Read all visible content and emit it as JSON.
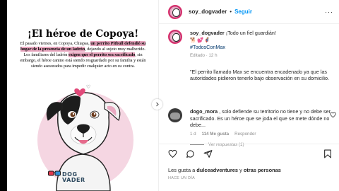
{
  "post_image": {
    "title": "¡El héroe de Copoya!",
    "body_1": "El pasado viernes, en Copoya, Chiapas, ",
    "body_2": "un perrito Pitbull defendió su hogar de la presencia de un ladrón",
    "body_3": ", dejando al sujeto muy malherido. Los familiares del ladrón ",
    "body_4": "exigen que el perrito sea sacrificado",
    "body_5": ", sin embargo, el héroe canino está siendo resguardado por su familia y están siendo asesorados para impedir cualquier acto en su contra.",
    "logo_line1": "DOG",
    "logo_line2": "VADER"
  },
  "header": {
    "username": "soy_dogvader",
    "separator": "•",
    "follow_label": "Seguir",
    "more_label": "···"
  },
  "caption": {
    "username": "soy_dogvader",
    "text": " ¡Todo un fiel guardián!",
    "emojis": "🐕💕🦸",
    "hashtag": "#TodosConMax",
    "quote": "\"El perrito llamado Max se encuentra encadenado ya que las autoridades pidieron tenerlo bajo observación en su domicilio.",
    "meta": "Editado · 12 h"
  },
  "comment": {
    "username": "dogo_mora",
    "text": " , solo defiende su territorio no tiene y no debe ser sacrificado. Es un héroe que se joda el que se mete dónde no debe...",
    "age": "1 d",
    "likes": "114 Me gusta",
    "reply": "Responder",
    "replies_label": "Ver respuestas (1)"
  },
  "likes": {
    "prefix": "Les gusta a ",
    "user": "dulceadventures",
    "middle": " y ",
    "others": "otras personas"
  },
  "date": "HACE UN DÍA",
  "colors": {
    "accent": "#0095f6",
    "text": "#262626",
    "muted": "#8e8e8e",
    "hashtag": "#00376b",
    "highlight": "#e8a5be"
  }
}
